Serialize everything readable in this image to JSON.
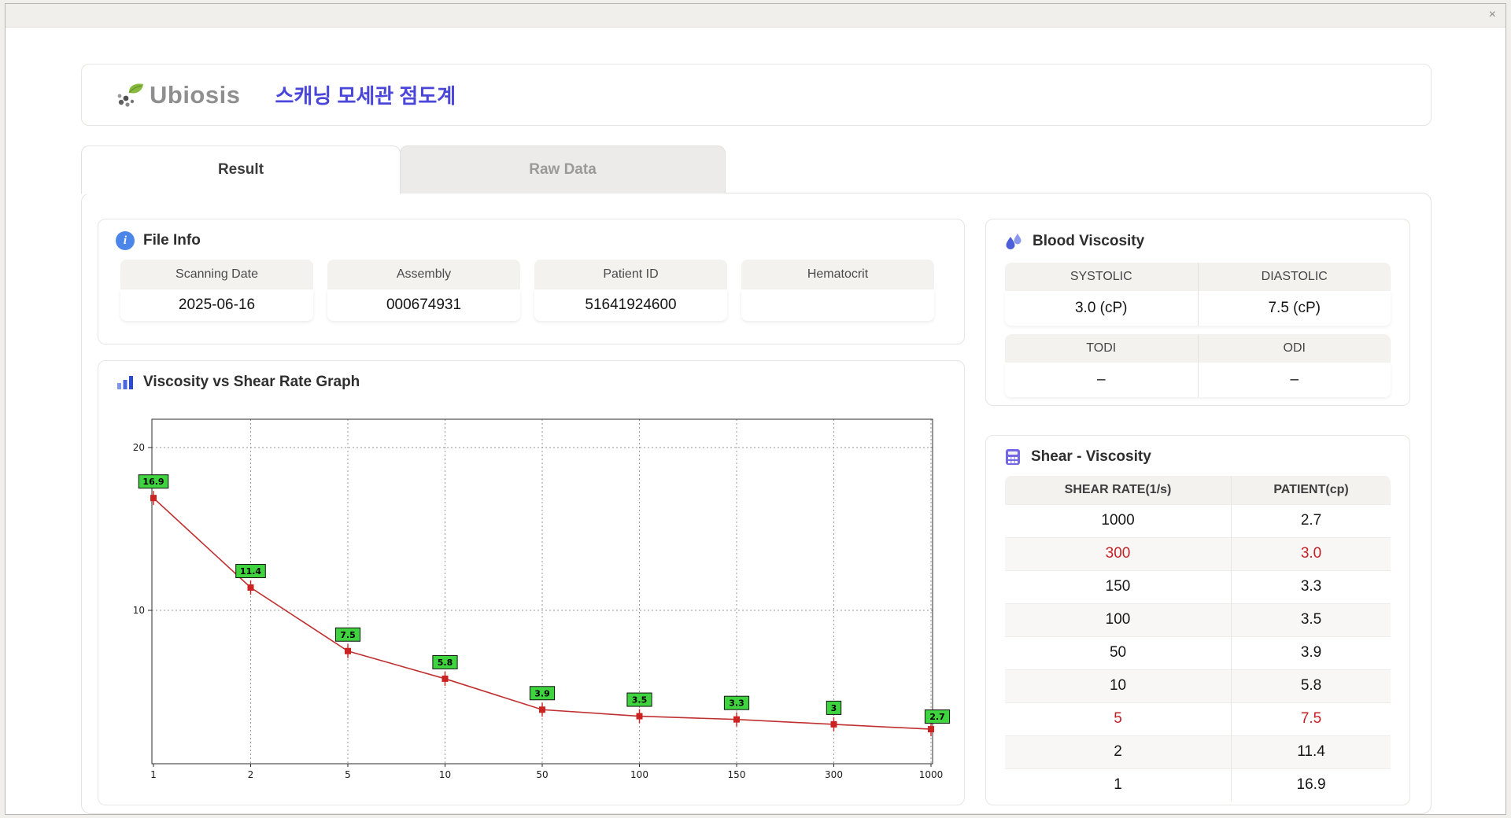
{
  "window": {
    "title_area": ""
  },
  "icons": {
    "close_glyph": "×",
    "info_glyph": "i",
    "logo": "leaf-dots-icon",
    "blood": "water-drops-icon",
    "graph": "bar-chart-icon",
    "shear": "grid-calculator-icon"
  },
  "colors": {
    "accent_blue": "#4a46da",
    "highlight_red": "#c32126",
    "point_label_green": "#3fd43f",
    "line_red": "#c03030"
  },
  "header": {
    "logo_text": "Ubiosis",
    "title": "스캐닝 모세관 점도계"
  },
  "tabs": [
    {
      "label": "Result",
      "active": true
    },
    {
      "label": "Raw Data",
      "active": false
    }
  ],
  "file_info": {
    "title": "File Info",
    "fields": [
      {
        "label": "Scanning Date",
        "value": "2025-06-16"
      },
      {
        "label": "Assembly",
        "value": "000674931"
      },
      {
        "label": "Patient ID",
        "value": "51641924600"
      },
      {
        "label": "Hematocrit",
        "value": ""
      }
    ]
  },
  "blood_viscosity": {
    "title": "Blood Viscosity",
    "groups": [
      {
        "labels": [
          "SYSTOLIC",
          "DIASTOLIC"
        ],
        "values": [
          "3.0 (cP)",
          "7.5 (cP)"
        ]
      },
      {
        "labels": [
          "TODI",
          "ODI"
        ],
        "values": [
          "–",
          "–"
        ]
      }
    ]
  },
  "graph": {
    "title": "Viscosity vs Shear Rate Graph"
  },
  "chart_data": {
    "type": "line",
    "title": "Viscosity vs Shear Rate Graph",
    "x": [
      1,
      2,
      5,
      10,
      50,
      100,
      150,
      300,
      1000
    ],
    "values": [
      16.9,
      11.4,
      7.5,
      5.8,
      3.9,
      3.5,
      3.3,
      3.0,
      2.7
    ],
    "point_labels": [
      "16.9",
      "11.4",
      "7.5",
      "5.8",
      "3.9",
      "3.5",
      "3.3",
      "3",
      "2.7"
    ],
    "x_ticks": [
      "1",
      "2",
      "5",
      "10",
      "50",
      "100",
      "150",
      "300",
      "1000"
    ],
    "y_ticks": [
      "10",
      "20"
    ],
    "ylim": [
      0,
      21.7
    ],
    "x_spacing": "equal spacing per tick (log-like axis)",
    "grid": "dotted",
    "legend": "none",
    "line_color": "#c03030",
    "marker_color": "#cc2222",
    "point_label_bg": "#3fd43f"
  },
  "shear_table": {
    "title": "Shear - Viscosity",
    "columns": [
      "SHEAR RATE(1/s)",
      "PATIENT(cp)"
    ],
    "rows": [
      {
        "shear": "1000",
        "patient": "2.7",
        "highlight": false
      },
      {
        "shear": "300",
        "patient": "3.0",
        "highlight": true
      },
      {
        "shear": "150",
        "patient": "3.3",
        "highlight": false
      },
      {
        "shear": "100",
        "patient": "3.5",
        "highlight": false
      },
      {
        "shear": "50",
        "patient": "3.9",
        "highlight": false
      },
      {
        "shear": "10",
        "patient": "5.8",
        "highlight": false
      },
      {
        "shear": "5",
        "patient": "7.5",
        "highlight": true
      },
      {
        "shear": "2",
        "patient": "11.4",
        "highlight": false
      },
      {
        "shear": "1",
        "patient": "16.9",
        "highlight": false
      }
    ]
  }
}
